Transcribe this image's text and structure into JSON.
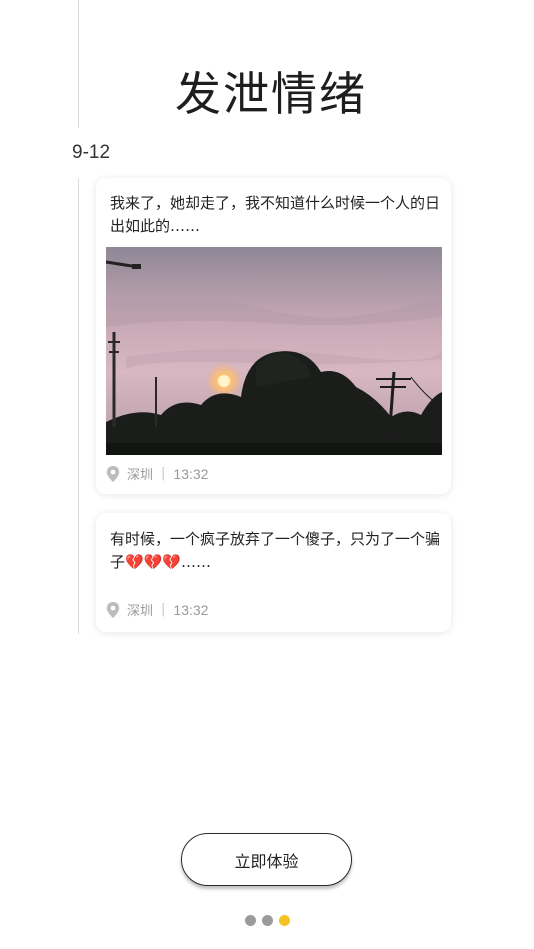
{
  "title": "发泄情绪",
  "date": "9-12",
  "posts": [
    {
      "text": "我来了，她却走了，我不知道什么时候一个人的日出如此的……",
      "has_photo": true,
      "location": "深圳",
      "separator": "|",
      "time": "13:32"
    },
    {
      "text": "有时候，一个疯子放弃了一个傻子，只为了一个骗子💔💔💔……",
      "has_photo": false,
      "location": "深圳",
      "separator": "|",
      "time": "13:32"
    }
  ],
  "cta_label": "立即体验",
  "pager": {
    "count": 3,
    "active_index": 2
  },
  "colors": {
    "accent": "#f6c324",
    "dot_inactive": "#9b9b9b",
    "meta_text": "#9a9a9a"
  },
  "icons": {
    "location": "location-pin-icon"
  }
}
